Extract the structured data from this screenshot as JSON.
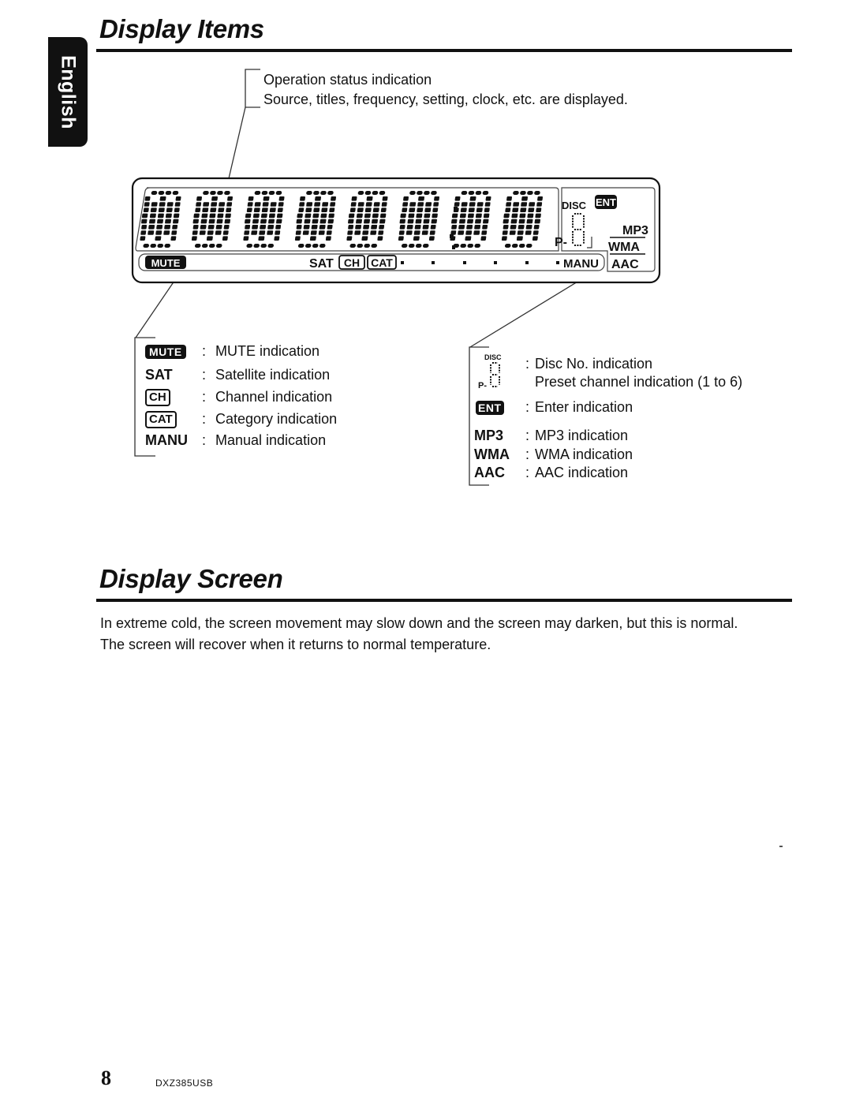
{
  "language_tab": "English",
  "sections": {
    "display_items": {
      "title": "Display Items",
      "callout_top": {
        "line1": "Operation status indication",
        "line2": "Source, titles, frequency, setting, clock, etc. are displayed."
      }
    },
    "display_screen": {
      "title": "Display Screen",
      "paragraph_line1": "In extreme cold, the screen movement may slow down and the screen may darken, but this is normal.",
      "paragraph_line2": "The screen will recover when it returns to normal temperature."
    }
  },
  "lcd": {
    "digit_count": 8,
    "labels": {
      "mute": "MUTE",
      "sat": "SAT",
      "ch": "CH",
      "cat": "CAT",
      "manu": "MANU",
      "disc": "DISC",
      "ent": "ENT",
      "preset_prefix": "P-",
      "mp3": "MP3",
      "wma": "WMA",
      "aac": "AAC"
    }
  },
  "legend_left": [
    {
      "symbol": "MUTE",
      "style": "solid",
      "description": "MUTE indication"
    },
    {
      "symbol": "SAT",
      "style": "text",
      "description": "Satellite indication"
    },
    {
      "symbol": "CH",
      "style": "outline",
      "description": "Channel indication"
    },
    {
      "symbol": "CAT",
      "style": "outline",
      "description": "Category indication"
    },
    {
      "symbol": "MANU",
      "style": "text",
      "description": "Manual indication"
    }
  ],
  "legend_right": {
    "disc_symbol_label": "DISC",
    "preset_symbol_label": "P-",
    "disc_description": "Disc No. indication",
    "preset_description": "Preset channel indication (1 to 6)",
    "items": [
      {
        "symbol": "ENT",
        "style": "solid",
        "description": "Enter indication"
      },
      {
        "symbol": "MP3",
        "style": "text",
        "description": "MP3 indication"
      },
      {
        "symbol": "WMA",
        "style": "text",
        "description": "WMA indication"
      },
      {
        "symbol": "AAC",
        "style": "text",
        "description": "AAC indication"
      }
    ]
  },
  "footer": {
    "page_number": "8",
    "model": "DXZ385USB"
  }
}
